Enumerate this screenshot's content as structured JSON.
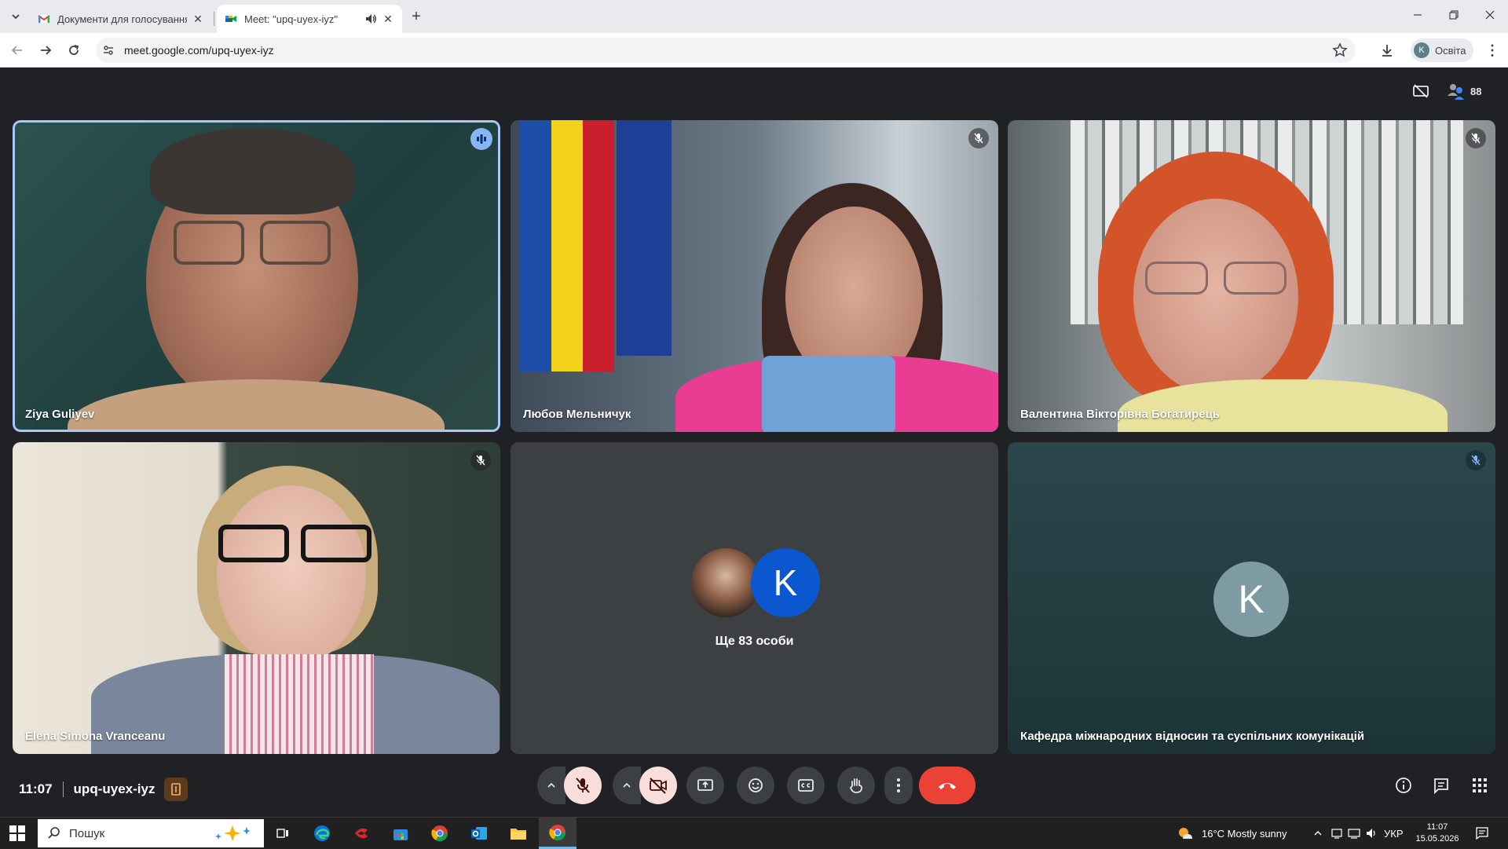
{
  "browser": {
    "tabs": [
      {
        "title": "Документи для голосування -",
        "icon": "gmail-icon"
      },
      {
        "title": "Meet: \"upq-uyex-iyz\"",
        "icon": "meet-icon",
        "audio": "speaker-icon"
      }
    ],
    "url": "meet.google.com/upq-uyex-iyz",
    "profile": {
      "initial": "K",
      "name": "Освіта"
    }
  },
  "meet": {
    "participant_count": "88",
    "tiles": [
      {
        "name": "Ziya Guliyev",
        "status": "speaking"
      },
      {
        "name": "Любов Мельничук",
        "status": "muted"
      },
      {
        "name": "Валентина Вікторівна Богатирець",
        "status": "muted"
      },
      {
        "name": "Elena Simona Vranceanu",
        "status": "muted"
      },
      {
        "more_label": "Ще 83 особи",
        "avatar_initial": "K"
      },
      {
        "name": "Кафедра міжнародних відносин та суспільних комунікацій",
        "avatar_initial": "K",
        "status": "muted"
      }
    ],
    "bottom": {
      "time": "11:07",
      "meeting_code": "upq-uyex-iyz"
    }
  },
  "taskbar": {
    "search_placeholder": "Пошук",
    "weather": "16°C  Mostly sunny",
    "language": "УКР",
    "time": "11:07",
    "date": "15.05.2026"
  },
  "colors": {
    "meet_bg": "#202124",
    "active_border": "#a8c7fa",
    "hangup": "#ea4335",
    "avatar_blue": "#0b57d0"
  }
}
